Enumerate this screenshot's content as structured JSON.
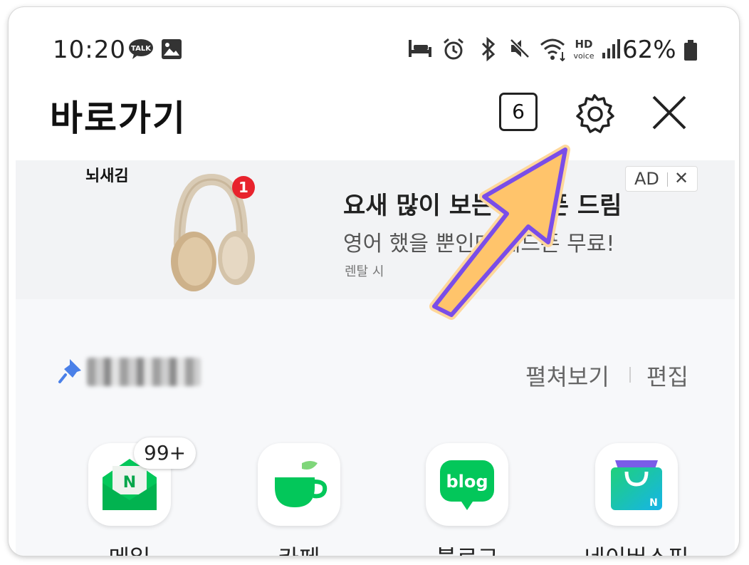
{
  "status_bar": {
    "time": "10:20",
    "battery": "62%",
    "talk_icon_text": "TALK",
    "hd_voice_top": "HD",
    "hd_voice_bottom": "voice"
  },
  "header": {
    "title": "바로가기",
    "tab_count": "6"
  },
  "ad": {
    "brand": "뇌새김",
    "badge_count": "1",
    "badge_label": "AD",
    "badge_close": "✕",
    "headline": "요새 많이 보는 헤드폰 드림",
    "subline": "영어 했을 뿐인데 헤드폰 무료!",
    "meta": "렌탈 시"
  },
  "pinned": {
    "expand": "펼쳐보기",
    "edit": "편집"
  },
  "shortcuts": [
    {
      "label": "메일",
      "badge": "99+"
    },
    {
      "label": "카페"
    },
    {
      "label": "블로그",
      "icon_text": "blog"
    },
    {
      "label": "네이버쇼핑",
      "icon_text": "N"
    }
  ],
  "icons": {
    "mail_letter": "N"
  },
  "colors": {
    "naver_green": "#03c75a",
    "arrow_fill": "#ffc46b",
    "arrow_stroke": "#7a4de8",
    "badge_red": "#e8232d"
  }
}
